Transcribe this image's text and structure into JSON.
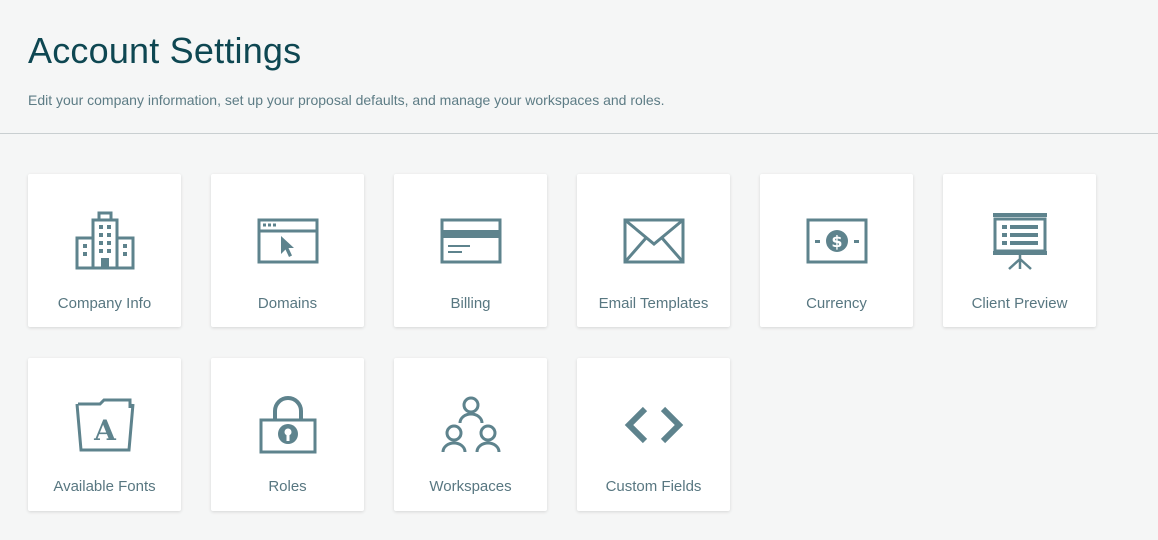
{
  "header": {
    "title": "Account Settings",
    "subtitle": "Edit your company information, set up your proposal defaults, and manage your workspaces and roles."
  },
  "theme": {
    "title_color": "#0e4752",
    "icon_color": "#5e838d",
    "label_color": "#587781",
    "background": "#f5f6f6"
  },
  "tiles": [
    {
      "label": "Company Info",
      "icon": "building-icon"
    },
    {
      "label": "Domains",
      "icon": "browser-cursor-icon"
    },
    {
      "label": "Billing",
      "icon": "credit-card-icon"
    },
    {
      "label": "Email Templates",
      "icon": "envelope-icon"
    },
    {
      "label": "Currency",
      "icon": "dollar-bill-icon"
    },
    {
      "label": "Client Preview",
      "icon": "presentation-board-icon"
    },
    {
      "label": "Available Fonts",
      "icon": "font-folder-icon"
    },
    {
      "label": "Roles",
      "icon": "padlock-icon"
    },
    {
      "label": "Workspaces",
      "icon": "team-icon"
    },
    {
      "label": "Custom Fields",
      "icon": "code-brackets-icon"
    }
  ]
}
